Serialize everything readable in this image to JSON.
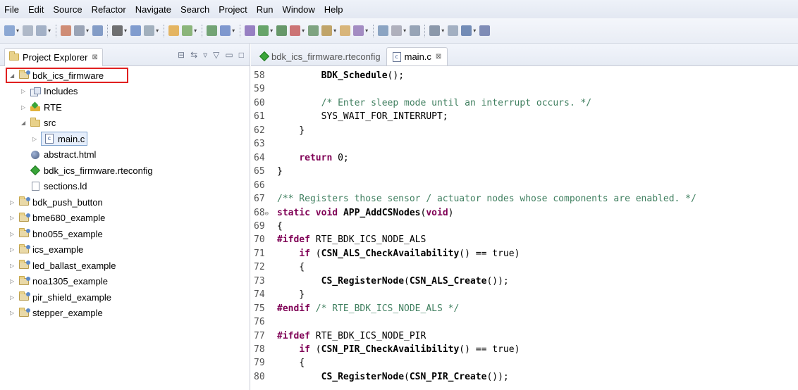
{
  "menubar": {
    "items": [
      "File",
      "Edit",
      "Source",
      "Refactor",
      "Navigate",
      "Search",
      "Project",
      "Run",
      "Window",
      "Help"
    ]
  },
  "project_explorer": {
    "title": "Project Explorer",
    "close_glyph": "⊠",
    "tree": [
      {
        "label": "bdk_ics_firmware",
        "icon": "project-folder-icon",
        "twisty": "▲",
        "level": 0
      },
      {
        "label": "Includes",
        "icon": "includes-icon",
        "twisty": "▷",
        "level": 1
      },
      {
        "label": "RTE",
        "icon": "rte-icon",
        "twisty": "▷",
        "level": 1
      },
      {
        "label": "src",
        "icon": "folder-icon",
        "twisty": "▲",
        "level": 1
      },
      {
        "label": "main.c",
        "icon": "c-file-icon",
        "twisty": "▷",
        "level": 2
      },
      {
        "label": "abstract.html",
        "icon": "globe-icon",
        "twisty": "",
        "level": 1
      },
      {
        "label": "bdk_ics_firmware.rteconfig",
        "icon": "diamond-icon",
        "twisty": "",
        "level": 1
      },
      {
        "label": "sections.ld",
        "icon": "document-icon",
        "twisty": "",
        "level": 1
      },
      {
        "label": "bdk_push_button",
        "icon": "project-folder-icon",
        "twisty": "▷",
        "level": 0
      },
      {
        "label": "bme680_example",
        "icon": "project-folder-icon",
        "twisty": "▷",
        "level": 0
      },
      {
        "label": "bno055_example",
        "icon": "project-folder-icon",
        "twisty": "▷",
        "level": 0
      },
      {
        "label": "ics_example",
        "icon": "project-folder-icon",
        "twisty": "▷",
        "level": 0
      },
      {
        "label": "led_ballast_example",
        "icon": "project-folder-icon",
        "twisty": "▷",
        "level": 0
      },
      {
        "label": "noa1305_example",
        "icon": "project-folder-icon",
        "twisty": "▷",
        "level": 0
      },
      {
        "label": "pir_shield_example",
        "icon": "project-folder-icon",
        "twisty": "▷",
        "level": 0
      },
      {
        "label": "stepper_example",
        "icon": "project-folder-icon",
        "twisty": "▷",
        "level": 0
      }
    ]
  },
  "editor": {
    "tabs": [
      {
        "label": "bdk_ics_firmware.rteconfig",
        "active": false,
        "icon": "diamond-icon"
      },
      {
        "label": "main.c",
        "active": true,
        "icon": "c-file-icon",
        "close_glyph": "⊠"
      }
    ],
    "lines": [
      {
        "n": "58",
        "segments": [
          {
            "t": "        "
          },
          {
            "t": "BDK_Schedule",
            "c": "fn"
          },
          {
            "t": "();"
          }
        ]
      },
      {
        "n": "59",
        "segments": []
      },
      {
        "n": "60",
        "segments": [
          {
            "t": "        "
          },
          {
            "t": "/* Enter sleep mode until an interrupt occurs. */",
            "c": "cm"
          }
        ]
      },
      {
        "n": "61",
        "segments": [
          {
            "t": "        SYS_WAIT_FOR_INTERRUPT;"
          }
        ]
      },
      {
        "n": "62",
        "segments": [
          {
            "t": "    }"
          }
        ]
      },
      {
        "n": "63",
        "segments": []
      },
      {
        "n": "64",
        "segments": [
          {
            "t": "    "
          },
          {
            "t": "return",
            "c": "kw"
          },
          {
            "t": " 0;"
          }
        ]
      },
      {
        "n": "65",
        "segments": [
          {
            "t": "}"
          }
        ]
      },
      {
        "n": "66",
        "segments": []
      },
      {
        "n": "67",
        "segments": [
          {
            "t": "/** Registers those sensor / actuator nodes whose components are enabled. */",
            "c": "cm"
          }
        ]
      },
      {
        "n": "68",
        "fold": "⊖",
        "segments": [
          {
            "t": "static",
            "c": "kw"
          },
          {
            "t": " "
          },
          {
            "t": "void",
            "c": "kw"
          },
          {
            "t": " "
          },
          {
            "t": "APP_AddCSNodes",
            "c": "fn"
          },
          {
            "t": "("
          },
          {
            "t": "void",
            "c": "kw"
          },
          {
            "t": ")"
          }
        ]
      },
      {
        "n": "69",
        "segments": [
          {
            "t": "{"
          }
        ]
      },
      {
        "n": "70",
        "segments": [
          {
            "t": "#ifdef",
            "c": "kw"
          },
          {
            "t": " RTE_BDK_ICS_NODE_ALS"
          }
        ]
      },
      {
        "n": "71",
        "segments": [
          {
            "t": "    "
          },
          {
            "t": "if",
            "c": "kw"
          },
          {
            "t": " ("
          },
          {
            "t": "CSN_ALS_CheckAvailability",
            "c": "fn"
          },
          {
            "t": "() == true)"
          }
        ]
      },
      {
        "n": "72",
        "segments": [
          {
            "t": "    {"
          }
        ]
      },
      {
        "n": "73",
        "segments": [
          {
            "t": "        "
          },
          {
            "t": "CS_RegisterNode",
            "c": "fn"
          },
          {
            "t": "("
          },
          {
            "t": "CSN_ALS_Create",
            "c": "fn"
          },
          {
            "t": "());"
          }
        ]
      },
      {
        "n": "74",
        "segments": [
          {
            "t": "    }"
          }
        ]
      },
      {
        "n": "75",
        "segments": [
          {
            "t": "#endif",
            "c": "kw"
          },
          {
            "t": " "
          },
          {
            "t": "/* RTE_BDK_ICS_NODE_ALS */",
            "c": "cm"
          }
        ]
      },
      {
        "n": "76",
        "segments": []
      },
      {
        "n": "77",
        "segments": [
          {
            "t": "#ifdef",
            "c": "kw"
          },
          {
            "t": " RTE_BDK_ICS_NODE_PIR"
          }
        ]
      },
      {
        "n": "78",
        "segments": [
          {
            "t": "    "
          },
          {
            "t": "if",
            "c": "kw"
          },
          {
            "t": " ("
          },
          {
            "t": "CSN_PIR_CheckAvailibility",
            "c": "fn"
          },
          {
            "t": "() == true)"
          }
        ]
      },
      {
        "n": "79",
        "segments": [
          {
            "t": "    {"
          }
        ]
      },
      {
        "n": "80",
        "segments": [
          {
            "t": "        "
          },
          {
            "t": "CS_RegisterNode",
            "c": "fn"
          },
          {
            "t": "("
          },
          {
            "t": "CSN_PIR_Create",
            "c": "fn"
          },
          {
            "t": "());"
          }
        ]
      }
    ]
  },
  "colors": {
    "keyword": "#7f0055",
    "comment": "#3f7f5f",
    "highlight_box": "#e02020"
  }
}
